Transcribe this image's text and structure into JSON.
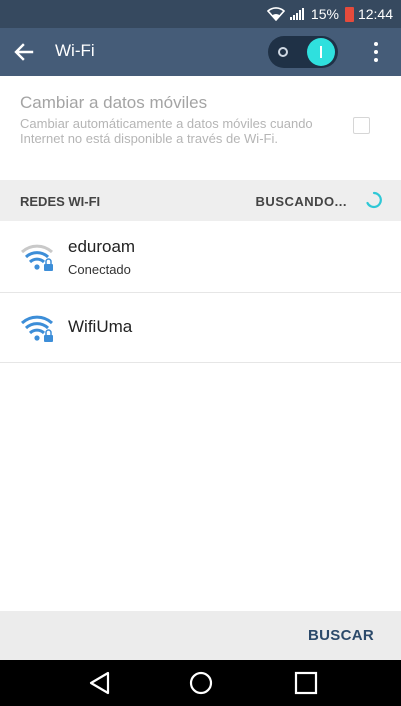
{
  "status_bar": {
    "battery": "15%",
    "time": "12:44"
  },
  "app_bar": {
    "title": "Wi-Fi",
    "wifi_toggle": "on"
  },
  "mobile_data": {
    "title": "Cambiar a datos móviles",
    "description": "Cambiar automáticamente a datos móviles cuando Internet no está disponible a través de Wi-Fi.",
    "checked": false
  },
  "section": {
    "label": "REDES WI-FI",
    "status": "BUSCANDO..."
  },
  "networks": [
    {
      "name": "eduroam",
      "status": "Conectado",
      "secured": true
    },
    {
      "name": "WifiUma",
      "status": "",
      "secured": true
    }
  ],
  "bottom": {
    "action_label": "BUSCAR"
  },
  "colors": {
    "accent": "#2fe0de",
    "app_bar": "#455c78",
    "status_bar": "#36495f",
    "wifi_icon": "#3d8ed8"
  }
}
